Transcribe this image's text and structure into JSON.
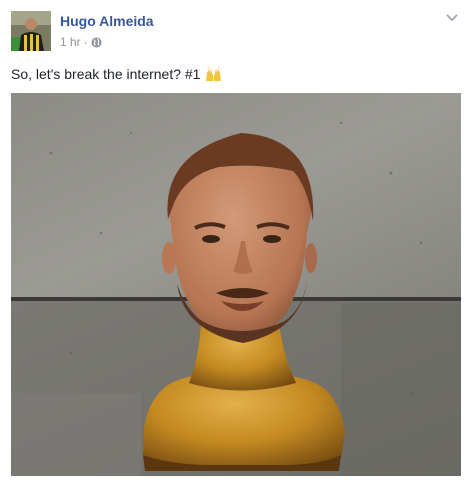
{
  "post": {
    "author": "Hugo Almeida",
    "time": "1 hr",
    "separator": "·",
    "privacy_icon": "globe-icon",
    "menu_icon": "chevron-down-icon",
    "text": "So, let's break the internet? #1",
    "emoji": "raising-hands-emoji"
  },
  "colors": {
    "author_link": "#365899",
    "meta_text": "#90949c",
    "body_text": "#1d2129"
  }
}
